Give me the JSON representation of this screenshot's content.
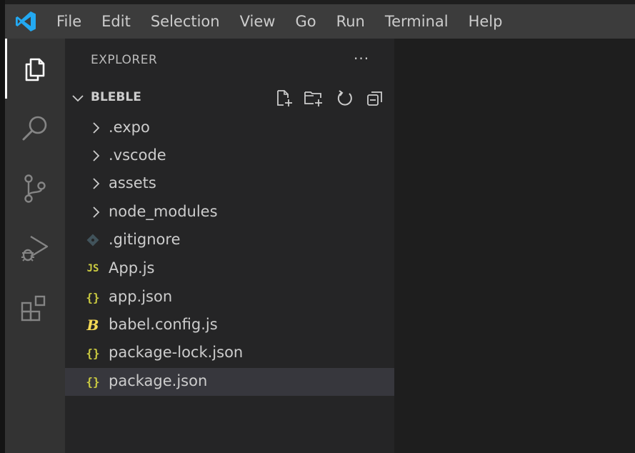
{
  "menubar": {
    "logo_icon": "vscode-logo-icon",
    "items": [
      "File",
      "Edit",
      "Selection",
      "View",
      "Go",
      "Run",
      "Terminal",
      "Help"
    ]
  },
  "activitybar": {
    "items": [
      {
        "icon": "explorer-icon",
        "active": true
      },
      {
        "icon": "search-icon",
        "active": false
      },
      {
        "icon": "source-control-icon",
        "active": false
      },
      {
        "icon": "run-debug-icon",
        "active": false
      },
      {
        "icon": "extensions-icon",
        "active": false
      }
    ]
  },
  "sidebar": {
    "header": "EXPLORER",
    "more": "···",
    "root": {
      "label": "BLEBLE",
      "tools": [
        "new-file-icon",
        "new-folder-icon",
        "refresh-icon",
        "collapse-all-icon"
      ]
    },
    "tree": [
      {
        "label": ".expo",
        "type": "folder",
        "icon": "chevron-right-icon"
      },
      {
        "label": ".vscode",
        "type": "folder",
        "icon": "chevron-right-icon"
      },
      {
        "label": "assets",
        "type": "folder",
        "icon": "chevron-right-icon"
      },
      {
        "label": "node_modules",
        "type": "folder",
        "icon": "chevron-right-icon"
      },
      {
        "label": ".gitignore",
        "type": "file",
        "icon": "git-file-icon"
      },
      {
        "label": "App.js",
        "type": "file",
        "icon": "js-file-icon",
        "glyph": "JS"
      },
      {
        "label": "app.json",
        "type": "file",
        "icon": "json-file-icon",
        "glyph": "{}"
      },
      {
        "label": "babel.config.js",
        "type": "file",
        "icon": "babel-file-icon",
        "glyph": "B"
      },
      {
        "label": "package-lock.json",
        "type": "file",
        "icon": "json-file-icon",
        "glyph": "{}"
      },
      {
        "label": "package.json",
        "type": "file",
        "icon": "json-file-icon",
        "glyph": "{}",
        "selected": true
      }
    ]
  },
  "colors": {
    "menubar_bg": "#3c3c3c",
    "activitybar_bg": "#333333",
    "sidebar_bg": "#252526",
    "editor_bg": "#1e1e1e",
    "selected_row_bg": "#37373d",
    "vscode_blue": "#23a9f2",
    "json_yellow": "#cbcb41",
    "babel_yellow": "#f5da55"
  }
}
